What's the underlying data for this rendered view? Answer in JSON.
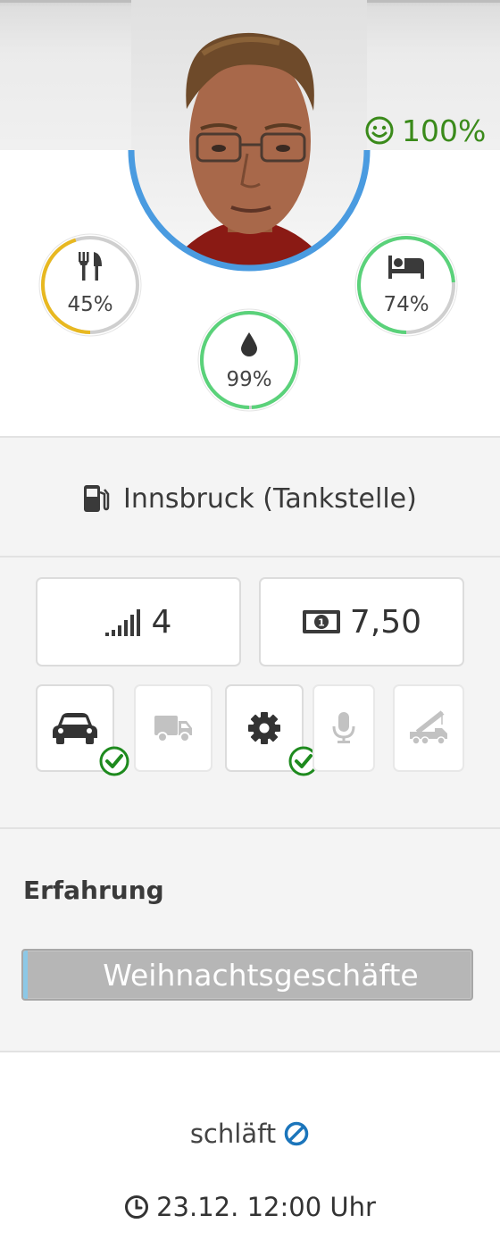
{
  "driver": {
    "happiness": "100%",
    "happiness_icon": "smile-icon",
    "avatar_ring_color": "#4a9be0"
  },
  "needs": {
    "food": {
      "value": "45%",
      "level": 0.45,
      "icon": "utensils-icon",
      "color": "#e8b820"
    },
    "drink": {
      "value": "99%",
      "level": 0.99,
      "icon": "water-drop-icon",
      "color": "#5ad27a"
    },
    "sleep": {
      "value": "74%",
      "level": 0.74,
      "icon": "bed-icon",
      "color": "#5ad27a"
    }
  },
  "location": {
    "text": "Innsbruck (Tankstelle)",
    "icon": "gas-station-icon"
  },
  "stats": {
    "level": {
      "value": "4",
      "icon": "signal-bars-icon"
    },
    "money": {
      "value": "7,50",
      "icon": "banknote-icon"
    }
  },
  "skills": [
    {
      "icon": "car-icon",
      "active": true
    },
    {
      "icon": "truck-icon",
      "active": false
    },
    {
      "icon": "gear-icon",
      "active": true
    },
    {
      "icon": "microphone-icon",
      "active": false
    },
    {
      "icon": "crane-truck-icon",
      "active": false
    }
  ],
  "experience": {
    "title": "Erfahrung",
    "bar_label": "Weihnachtsgeschäfte",
    "progress": 0.01
  },
  "status": {
    "text": "schläft",
    "icon": "ban-icon"
  },
  "time": {
    "text": "23.12. 12:00 Uhr",
    "icon": "clock-icon"
  },
  "colors": {
    "accent_green": "#3a8a1a",
    "check_green": "#1e8a1e",
    "ban_blue": "#1b75bb"
  }
}
